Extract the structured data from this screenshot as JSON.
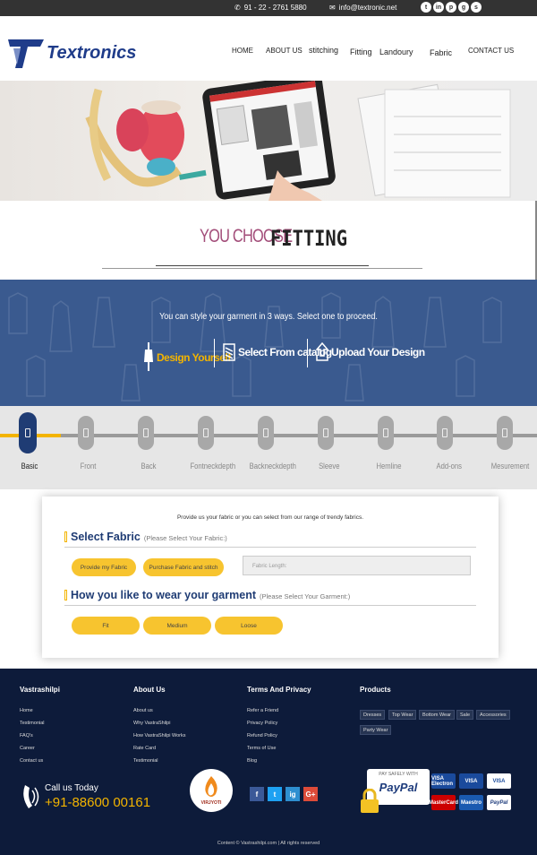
{
  "topbar": {
    "phone": "91 - 22 - 2761 5880",
    "email": "info@textronic.net",
    "social": [
      "twitter-icon",
      "linkedin-icon",
      "pinterest-icon",
      "google-plus-icon",
      "skype-icon"
    ]
  },
  "header": {
    "logo_text": "Textronics",
    "nav": [
      "HOME",
      "ABOUT US",
      "stitching",
      "Fitting",
      "Landoury",
      "Fabric",
      "CONTACT US"
    ]
  },
  "section_title": {
    "choose": "YOU CHOOSE",
    "fitting": "FITTING"
  },
  "style_options": {
    "message": "You can style your garment in 3 ways. Select one to proceed.",
    "options": [
      "Design Yourself",
      "Select From catalog",
      "Upload Your Design"
    ]
  },
  "steps": {
    "labels": [
      "Basic",
      "Front",
      "Back",
      "Fontneckdepth",
      "Backneckdepth",
      "Sleeve",
      "Hemline",
      "Add-ons",
      "Mesurement"
    ],
    "active_index": 0
  },
  "form": {
    "message": "Provide us your fabric or you can select from our range of trendy fabrics.",
    "fabric_heading": "Select Fabric",
    "fabric_sub": "(Please Select Your Fabric:)",
    "fabric_buttons": [
      "Provide my Fabric",
      "Purchase Fabric and stitch"
    ],
    "fabric_length_placeholder": "Fabric Length:",
    "garment_heading": "How you like to wear your garment",
    "garment_sub": "(Please Select Your Garment:)",
    "garment_buttons": [
      "Fit",
      "Medium",
      "Loose"
    ]
  },
  "footer": {
    "col1": {
      "title": "Vastrashilpi",
      "links": [
        "Home",
        "Testimonial",
        "FAQ's",
        "Career",
        "Contact us"
      ]
    },
    "col2": {
      "title": "About Us",
      "links": [
        "About us",
        "Why VastraShilpi",
        "How VastraShilpi Works",
        "Rate Card",
        "Testimonial"
      ]
    },
    "col3": {
      "title": "Terms And Privacy",
      "links": [
        "Refer a Friend",
        "Privacy Policy",
        "Refund Policy",
        "Terms of Use",
        "Blog"
      ]
    },
    "col4": {
      "title": "Products",
      "tags": [
        "Dresses",
        "Top Wear",
        "Bottom Wear",
        "Sale",
        "Accessories",
        "Party Wear"
      ]
    },
    "call_label": "Call us Today",
    "call_number": "+91-88600 00161",
    "brand_logo_text": "VIRJYOTI",
    "social": [
      "f",
      "t",
      "ig",
      "G+"
    ],
    "pay_safely": "PAY SAFELY WITH",
    "paypal": "PayPal",
    "cards": [
      "VISA Electron",
      "VISA",
      "VISA",
      "MasterCard",
      "Maestro",
      "PayPal"
    ],
    "copyright": "Content © Vastrashilpi.com | All rights reserved"
  },
  "colors": {
    "navy": "#1f3c74",
    "accent": "#f3b400",
    "blue_band": "#3a5a8f",
    "footer": "#0d1b3a"
  }
}
